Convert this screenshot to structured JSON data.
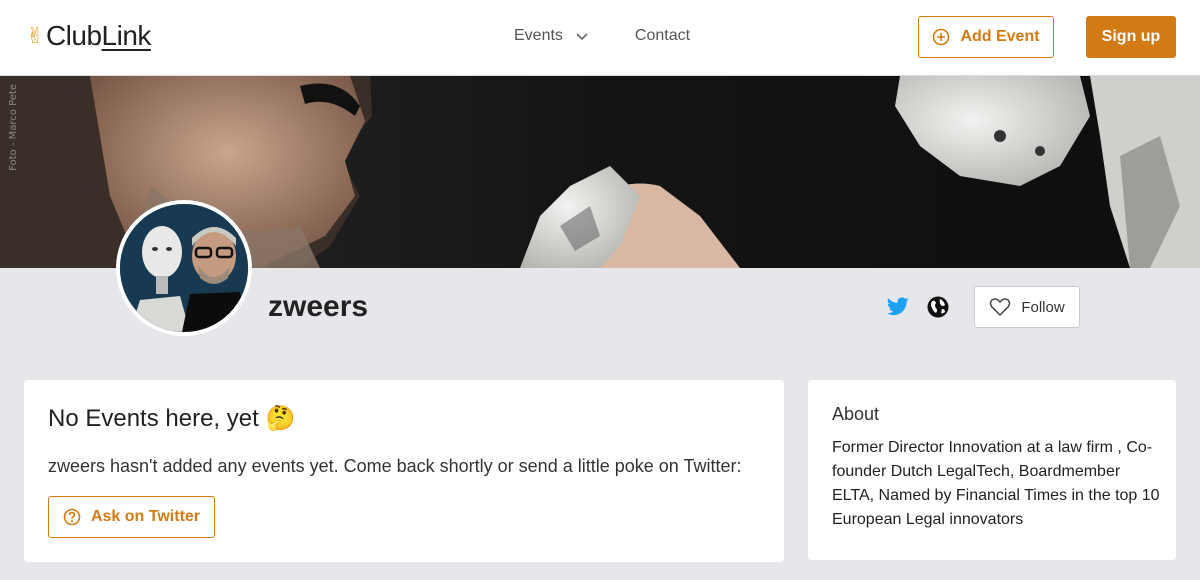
{
  "header": {
    "logo_prefix": "Club",
    "logo_link": "Link",
    "nav_events": "Events",
    "nav_contact": "Contact",
    "add_event_label": "Add Event",
    "signup_label": "Sign up"
  },
  "banner": {
    "credit": "Foto - Marco Pete"
  },
  "profile": {
    "username": "zweers",
    "follow_label": "Follow"
  },
  "events": {
    "title": "No Events here, yet 🤔",
    "message": "zweers hasn't added any events yet. Come back shortly or send a little poke on Twitter:",
    "ask_label": "Ask on Twitter"
  },
  "about": {
    "title": "About",
    "text": "Former Director Innovation at a law firm , Co-founder Dutch LegalTech, Boardmember ELTA, Named by Financial Times in the top 10 European Legal innovators"
  },
  "colors": {
    "accent": "#d27a13",
    "twitter": "#1da1f2",
    "background": "#e6e7ea"
  }
}
